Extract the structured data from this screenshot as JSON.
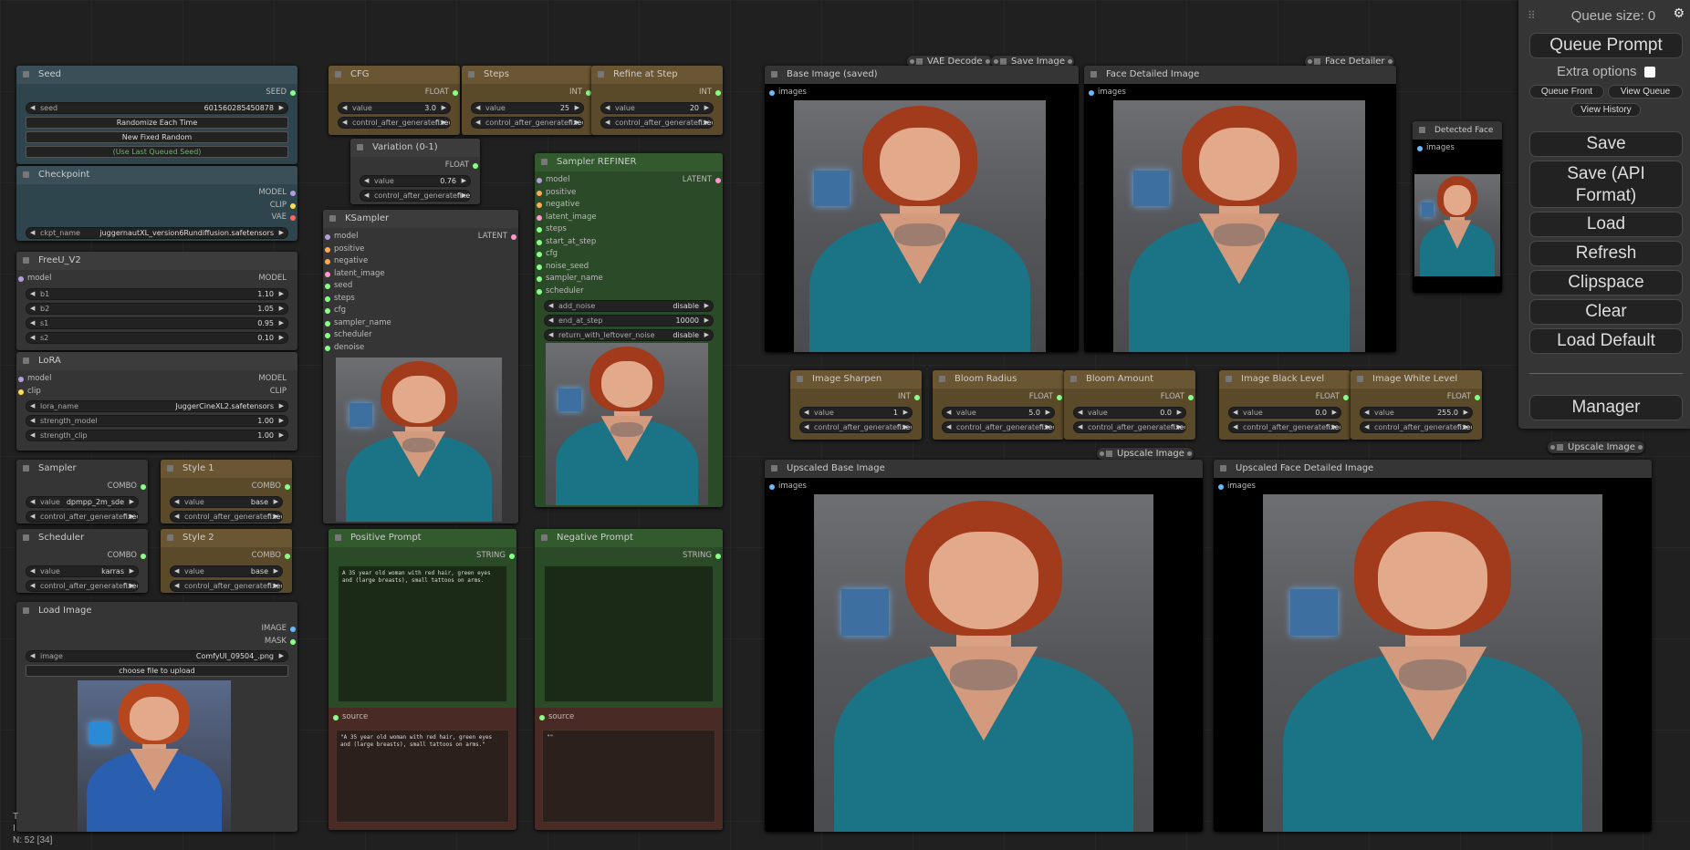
{
  "seed": {
    "title": "Seed",
    "out": "SEED",
    "seed_label": "seed",
    "seed_value": "601560285450878",
    "btn_random": "Randomize Each Time",
    "btn_fixed": "New Fixed Random",
    "btn_last": "(Use Last Queued Seed)"
  },
  "checkpoint": {
    "title": "Checkpoint",
    "out1": "MODEL",
    "out2": "CLIP",
    "out3": "VAE",
    "label": "ckpt_name",
    "value": "juggernautXL_version6Rundiffusion.safetensors"
  },
  "freeu": {
    "title": "FreeU_V2",
    "in": "model",
    "out": "MODEL",
    "rows": [
      {
        "k": "b1",
        "v": "1.10"
      },
      {
        "k": "b2",
        "v": "1.05"
      },
      {
        "k": "s1",
        "v": "0.95"
      },
      {
        "k": "s2",
        "v": "0.10"
      }
    ]
  },
  "lora": {
    "title": "LoRA",
    "in1": "model",
    "in2": "clip",
    "out1": "MODEL",
    "out2": "CLIP",
    "rows": [
      {
        "k": "lora_name",
        "v": "JuggerCineXL2.safetensors"
      },
      {
        "k": "strength_model",
        "v": "1.00"
      },
      {
        "k": "strength_clip",
        "v": "1.00"
      }
    ]
  },
  "sampler": {
    "title": "Sampler",
    "out": "COMBO",
    "label": "value",
    "value": "dpmpp_2m_sde",
    "cag": "control_after_generate",
    "cag_v": "fixed"
  },
  "scheduler": {
    "title": "Scheduler",
    "out": "COMBO",
    "label": "value",
    "value": "karras",
    "cag": "control_after_generate",
    "cag_v": "fixed"
  },
  "style1": {
    "title": "Style 1",
    "out": "COMBO",
    "label": "value",
    "value": "base",
    "cag": "control_after_generate",
    "cag_v": "fixed"
  },
  "style2": {
    "title": "Style 2",
    "out": "COMBO",
    "label": "value",
    "value": "base",
    "cag": "control_after_generate",
    "cag_v": "fixed"
  },
  "loadimg": {
    "title": "Load Image",
    "out1": "IMAGE",
    "out2": "MASK",
    "label": "image",
    "value": "ComfyUI_09504_.png",
    "upload": "choose file to upload"
  },
  "cfg": {
    "title": "CFG",
    "out": "FLOAT",
    "label": "value",
    "value": "3.0",
    "cag": "control_after_generate",
    "cag_v": "fixed"
  },
  "steps": {
    "title": "Steps",
    "out": "INT",
    "label": "value",
    "value": "25",
    "cag": "control_after_generate",
    "cag_v": "fixed"
  },
  "refine": {
    "title": "Refine at Step",
    "out": "INT",
    "label": "value",
    "value": "20",
    "cag": "control_after_generate",
    "cag_v": "fixed"
  },
  "variation": {
    "title": "Variation (0-1)",
    "out": "FLOAT",
    "label": "value",
    "value": "0.76",
    "cag": "control_after_generate",
    "cag_v": "fixed"
  },
  "ksampler": {
    "title": "KSampler",
    "out": "LATENT",
    "inputs": [
      "model",
      "positive",
      "negative",
      "latent_image",
      "seed",
      "steps",
      "cfg",
      "sampler_name",
      "scheduler",
      "denoise"
    ]
  },
  "refiner": {
    "title": "Sampler REFINER",
    "out": "LATENT",
    "inputs": [
      "model",
      "positive",
      "negative",
      "latent_image",
      "steps",
      "start_at_step",
      "cfg",
      "noise_seed",
      "sampler_name",
      "scheduler"
    ],
    "widgets": [
      {
        "k": "add_noise",
        "v": "disable"
      },
      {
        "k": "end_at_step",
        "v": "10000"
      },
      {
        "k": "return_with_leftover_noise",
        "v": "disable"
      }
    ]
  },
  "pos": {
    "title": "Positive Prompt",
    "out": "STRING",
    "text": "A 35 year old woman with red hair, green eyes and (large breasts), small tattoos on arms.",
    "source": "source",
    "source_text": "\"A 35 year old woman with red hair, green eyes and (large breasts), small tattoos on arms.\""
  },
  "neg": {
    "title": "Negative Prompt",
    "out": "STRING",
    "text": "",
    "source": "source",
    "source_text": "\"\""
  },
  "small": {
    "vae": "VAE Decode",
    "save": "Save Image",
    "fd": "Face Detailer",
    "up1": "Upscale Image",
    "up2": "Upscale Image"
  },
  "base": {
    "title": "Base Image (saved)",
    "in": "images"
  },
  "facedet": {
    "title": "Face Detailed Image",
    "in": "images"
  },
  "detected": {
    "title": "Detected Face",
    "in": "images"
  },
  "sharpen": {
    "title": "Image Sharpen",
    "out": "INT",
    "label": "value",
    "value": "1",
    "cag": "control_after_generate",
    "cag_v": "fixed"
  },
  "bradius": {
    "title": "Bloom Radius",
    "out": "FLOAT",
    "label": "value",
    "value": "5.0",
    "cag": "control_after_generate",
    "cag_v": "fixed"
  },
  "bamount": {
    "title": "Bloom Amount",
    "out": "FLOAT",
    "label": "value",
    "value": "0.0",
    "cag": "control_after_generate",
    "cag_v": "fixed"
  },
  "black": {
    "title": "Image Black Level",
    "out": "FLOAT",
    "label": "value",
    "value": "0.0",
    "cag": "control_after_generate",
    "cag_v": "fixed"
  },
  "white": {
    "title": "Image White Level",
    "out": "FLOAT",
    "label": "value",
    "value": "255.0",
    "cag": "control_after_generate",
    "cag_v": "fixed"
  },
  "upbase": {
    "title": "Upscaled Base Image",
    "in": "images"
  },
  "upface": {
    "title": "Upscaled Face Detailed Image",
    "in": "images"
  },
  "panel": {
    "queue_size": "Queue size: 0",
    "queue_prompt": "Queue Prompt",
    "extra": "Extra options",
    "queue_front": "Queue Front",
    "view_queue": "View Queue",
    "view_history": "View History",
    "save": "Save",
    "save_api": "Save (API Format)",
    "load": "Load",
    "refresh": "Refresh",
    "clipspace": "Clipspace",
    "clear": "Clear",
    "load_default": "Load Default",
    "manager": "Manager"
  },
  "status": {
    "line1": "T",
    "line2": "I",
    "line3": "N: 52 [34]"
  },
  "colors": {
    "green_node": "#2b4a27",
    "brown_node": "#5b4a2a",
    "slate_node": "#2e454d",
    "red_node": "#4a2a25"
  }
}
